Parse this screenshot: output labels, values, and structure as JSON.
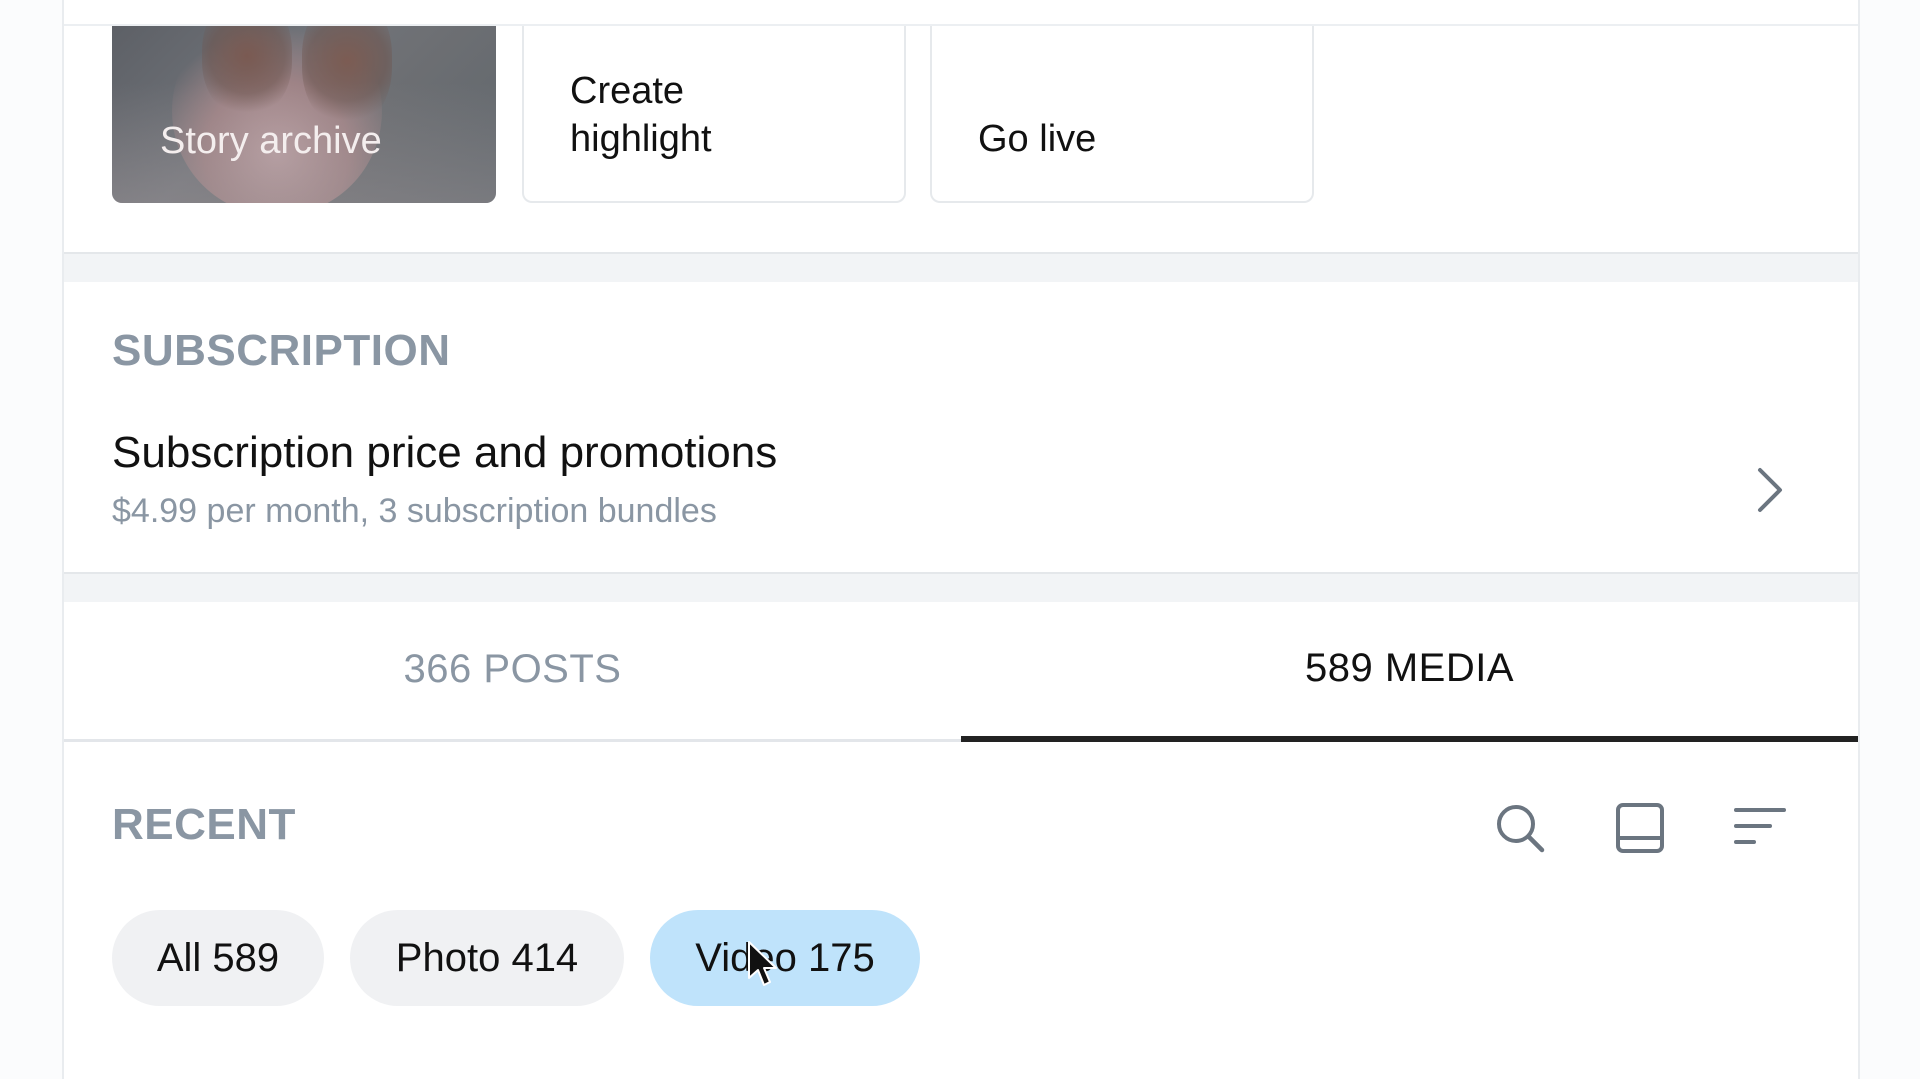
{
  "stories": {
    "archive_label": "Story archive",
    "create_highlight_label": "Create\nhighlight",
    "go_live_label": "Go live"
  },
  "subscription": {
    "section_title": "SUBSCRIPTION",
    "item_title": "Subscription price and promotions",
    "item_detail": "$4.99 per month, 3 subscription bundles"
  },
  "tabs": [
    {
      "label": "366 POSTS",
      "active": false
    },
    {
      "label": "589 MEDIA",
      "active": true
    }
  ],
  "media": {
    "section_title": "RECENT",
    "toolbar_icons": [
      "search-icon",
      "layout-icon",
      "sort-icon"
    ],
    "filters": [
      {
        "label": "All 589",
        "selected": false
      },
      {
        "label": "Photo 414",
        "selected": false
      },
      {
        "label": "Video 175",
        "selected": true
      }
    ]
  },
  "colors": {
    "muted_text": "#8a96a3",
    "selected_chip": "#bfe3fb",
    "chip": "#f0f1f3",
    "active_tab_underline": "#222222"
  }
}
